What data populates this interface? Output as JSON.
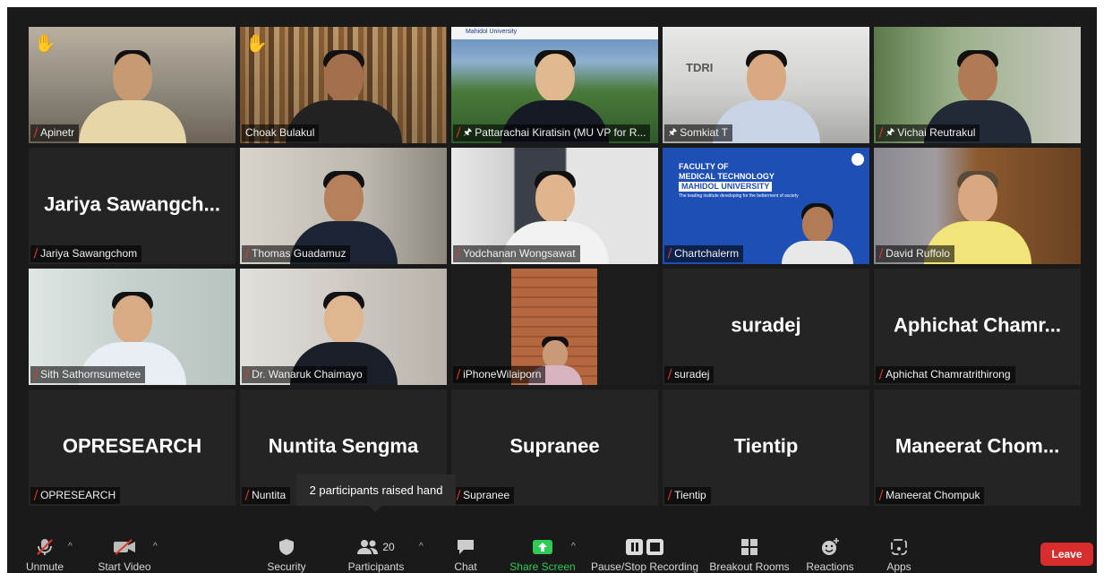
{
  "participants": [
    {
      "name": "Apinetr",
      "muted": true,
      "pinned": false,
      "raised_hand": true
    },
    {
      "name": "Choak Bulakul",
      "muted": false,
      "pinned": false,
      "raised_hand": true
    },
    {
      "name": "Pattarachai Kiratisin (MU VP for R...",
      "muted": true,
      "pinned": true,
      "raised_hand": false,
      "overlay": "Mahidol University"
    },
    {
      "name": "Somkiat T",
      "muted": false,
      "pinned": true,
      "raised_hand": false,
      "overlay": "TDRI"
    },
    {
      "name": "Vichai Reutrakul",
      "muted": true,
      "pinned": true,
      "raised_hand": false
    },
    {
      "name": "Jariya Sawangchom",
      "muted": true,
      "display": "Jariya  Sawangch..."
    },
    {
      "name": "Thomas Guadamuz",
      "muted": true
    },
    {
      "name": "Yodchanan Wongsawat",
      "muted": true
    },
    {
      "name": "Chartchalerm",
      "muted": true,
      "slide": {
        "line1": "FACULTY OF",
        "line2": "MEDICAL TECHNOLOGY",
        "line3": "MAHIDOL UNIVERSITY",
        "line4": "The leading institute developing for the betterment of society"
      }
    },
    {
      "name": "David Ruffolo",
      "muted": true
    },
    {
      "name": "Sith Sathornsumetee",
      "muted": true
    },
    {
      "name": "Dr. Wanaruk Chaimayo",
      "muted": true
    },
    {
      "name": "iPhoneWilaiporn",
      "muted": true
    },
    {
      "name": "suradej",
      "muted": true,
      "display": "suradej"
    },
    {
      "name": "Aphichat Chamratrithirong",
      "muted": true,
      "display": "Aphichat  Chamr..."
    },
    {
      "name": "OPRESEARCH",
      "muted": true,
      "display": "OPRESEARCH"
    },
    {
      "name": "Nuntita",
      "muted": true,
      "display": "Nuntita  Sengma"
    },
    {
      "name": "Supranee",
      "muted": true,
      "display": "Supranee"
    },
    {
      "name": "Tientip",
      "muted": true,
      "display": "Tientip"
    },
    {
      "name": "Maneerat Chompuk",
      "muted": true,
      "display": "Maneerat  Chom..."
    }
  ],
  "tooltip": "2 participants raised hand",
  "toolbar": {
    "unmute": "Unmute",
    "start_video": "Start Video",
    "security": "Security",
    "participants": "Participants",
    "participants_count": "20",
    "chat": "Chat",
    "share_screen": "Share Screen",
    "recording": "Pause/Stop Recording",
    "breakout": "Breakout Rooms",
    "reactions": "Reactions",
    "apps": "Apps",
    "leave": "Leave"
  },
  "colors": {
    "active_speaker": "#e9e05f",
    "leave": "#d92d2d",
    "share": "#2fcc55",
    "muted": "#e0372b"
  }
}
